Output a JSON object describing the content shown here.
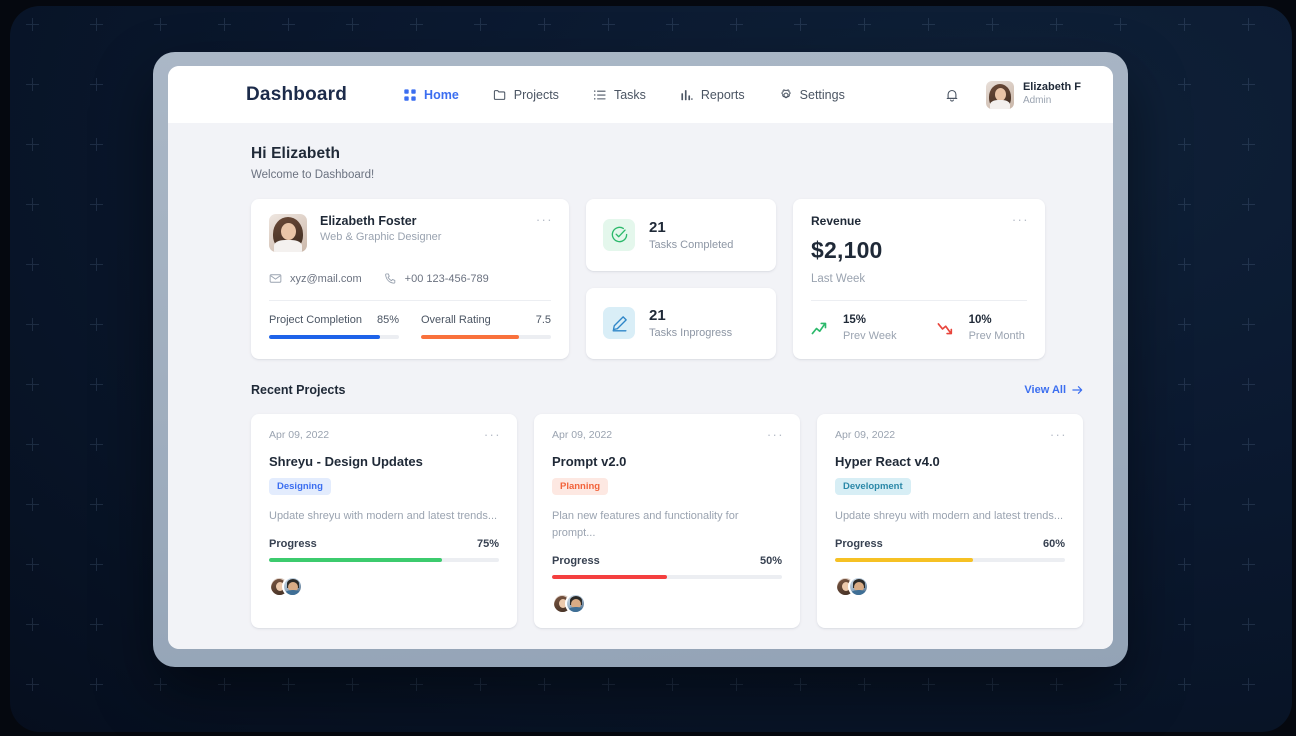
{
  "navbar": {
    "brand": "Dashboard",
    "items": [
      {
        "label": "Home",
        "icon": "grid-icon",
        "active": true
      },
      {
        "label": "Projects",
        "icon": "folder-icon",
        "active": false
      },
      {
        "label": "Tasks",
        "icon": "list-icon",
        "active": false
      },
      {
        "label": "Reports",
        "icon": "bar-chart-icon",
        "active": false
      },
      {
        "label": "Settings",
        "icon": "gear-icon",
        "active": false
      }
    ],
    "notification_icon": "bell-icon",
    "user": {
      "name": "Elizabeth F",
      "role": "Admin",
      "avatar": "user-avatar"
    }
  },
  "header": {
    "greeting": "Hi Elizabeth",
    "welcome": "Welcome to Dashboard!"
  },
  "profile_card": {
    "name": "Elizabeth Foster",
    "role": "Web & Graphic Designer",
    "menu": "···",
    "email": "xyz@mail.com",
    "phone": "+00 123-456-789",
    "metrics": [
      {
        "label": "Project Completion",
        "value": "85%",
        "percent": 85,
        "color": "#1e63e9"
      },
      {
        "label": "Overall Rating",
        "value": "7.5",
        "percent": 75,
        "color": "#f9713c"
      }
    ]
  },
  "stats": [
    {
      "number": "21",
      "label": "Tasks Completed",
      "icon": "check-circle-icon",
      "icon_bg": "#e4f7ec",
      "icon_color": "#2cb96b"
    },
    {
      "number": "21",
      "label": "Tasks Inprogress",
      "icon": "pencil-icon",
      "icon_bg": "#d9eef7",
      "icon_color": "#2e86c8"
    }
  ],
  "revenue_card": {
    "title": "Revenue",
    "menu": "···",
    "amount": "$2,100",
    "subtitle": "Last Week",
    "trends": [
      {
        "percent": "15%",
        "label": "Prev Week",
        "direction": "up",
        "icon": "trend-up-icon",
        "color": "#2cb96b"
      },
      {
        "percent": "10%",
        "label": "Prev Month",
        "direction": "down",
        "icon": "trend-down-icon",
        "color": "#e8453c"
      }
    ]
  },
  "recent": {
    "title": "Recent Projects",
    "view_all": "View All",
    "view_all_icon": "arrow-right-icon",
    "projects": [
      {
        "date": "Apr 09, 2022",
        "menu": "···",
        "title": "Shreyu - Design Updates",
        "tag": "Designing",
        "tag_bg": "#e3ecfd",
        "tag_color": "#3b6ef0",
        "description": "Update shreyu with modern and latest trends...",
        "progress_label": "Progress",
        "progress_value": "75%",
        "progress_percent": 75,
        "progress_color": "#3ccb6e"
      },
      {
        "date": "Apr 09, 2022",
        "menu": "···",
        "title": "Prompt v2.0",
        "tag": "Planning",
        "tag_bg": "#fde8e2",
        "tag_color": "#f2633b",
        "description": "Plan new features and functionality for prompt...",
        "progress_label": "Progress",
        "progress_value": "50%",
        "progress_percent": 50,
        "progress_color": "#f43f3f"
      },
      {
        "date": "Apr 09, 2022",
        "menu": "···",
        "title": "Hyper React v4.0",
        "tag": "Development",
        "tag_bg": "#d7eef5",
        "tag_color": "#2b88a8",
        "description": "Update shreyu with modern and latest trends...",
        "progress_label": "Progress",
        "progress_value": "60%",
        "progress_percent": 60,
        "progress_color": "#f6c124"
      }
    ]
  },
  "theme": {
    "accent": "#3b6ef0",
    "page_bg": "#f2f3f7",
    "card_bg": "#ffffff",
    "backdrop": "#0b1930",
    "device_frame": "#a3b1c2"
  }
}
